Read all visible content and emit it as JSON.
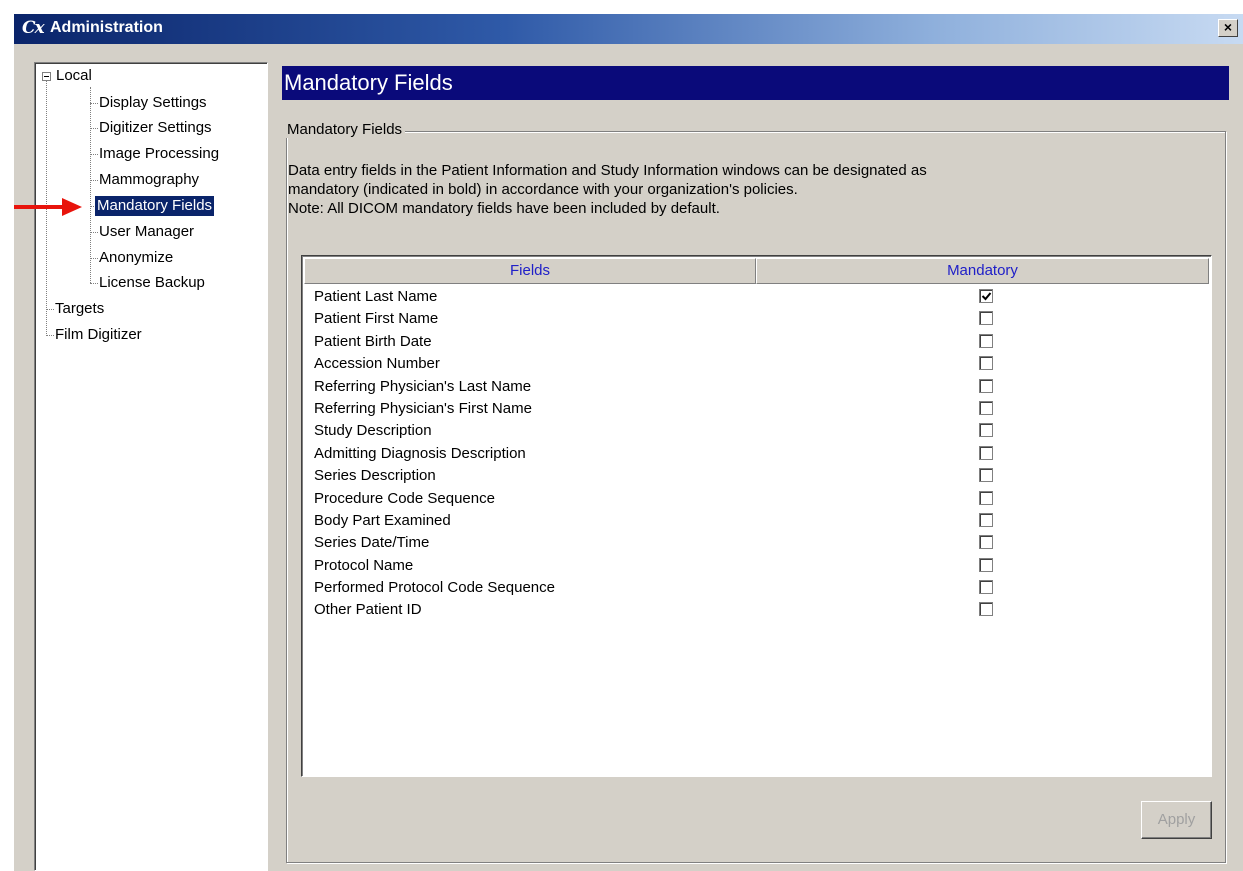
{
  "window": {
    "icon_text": "Cx",
    "title": "Administration",
    "close_label": "×"
  },
  "tree": {
    "root": "Local",
    "children": [
      "Display Settings",
      "Digitizer Settings",
      "Image Processing",
      "Mammography",
      "Mandatory Fields",
      "User Manager",
      "Anonymize",
      "License Backup"
    ],
    "selected": "Mandatory Fields",
    "siblings": [
      "Targets",
      "Film Digitizer"
    ]
  },
  "panel": {
    "header": "Mandatory Fields",
    "group_label": "Mandatory Fields",
    "description": [
      "Data entry fields in the Patient Information and Study Information windows can be designated as",
      "mandatory (indicated in bold) in accordance with your organization's policies.",
      "Note: All DICOM mandatory fields have been included by default."
    ]
  },
  "table": {
    "columns": [
      "Fields",
      "Mandatory"
    ],
    "rows": [
      {
        "field": "Patient Last Name",
        "mandatory": true
      },
      {
        "field": "Patient First Name",
        "mandatory": false
      },
      {
        "field": "Patient Birth Date",
        "mandatory": false
      },
      {
        "field": "Accession Number",
        "mandatory": false
      },
      {
        "field": "Referring Physician's Last Name",
        "mandatory": false
      },
      {
        "field": "Referring Physician's First Name",
        "mandatory": false
      },
      {
        "field": "Study Description",
        "mandatory": false
      },
      {
        "field": "Admitting Diagnosis Description",
        "mandatory": false
      },
      {
        "field": "Series Description",
        "mandatory": false
      },
      {
        "field": "Procedure Code Sequence",
        "mandatory": false
      },
      {
        "field": "Body Part Examined",
        "mandatory": false
      },
      {
        "field": "Series Date/Time",
        "mandatory": false
      },
      {
        "field": "Protocol Name",
        "mandatory": false
      },
      {
        "field": "Performed Protocol Code Sequence",
        "mandatory": false
      },
      {
        "field": "Other Patient ID",
        "mandatory": false
      }
    ]
  },
  "buttons": {
    "apply": "Apply",
    "apply_enabled": false
  },
  "colors": {
    "header_bg": "#0a0a7a",
    "selection_bg": "#0a246a",
    "arrow": "#e8140c",
    "column_header_text": "#2020c8"
  }
}
